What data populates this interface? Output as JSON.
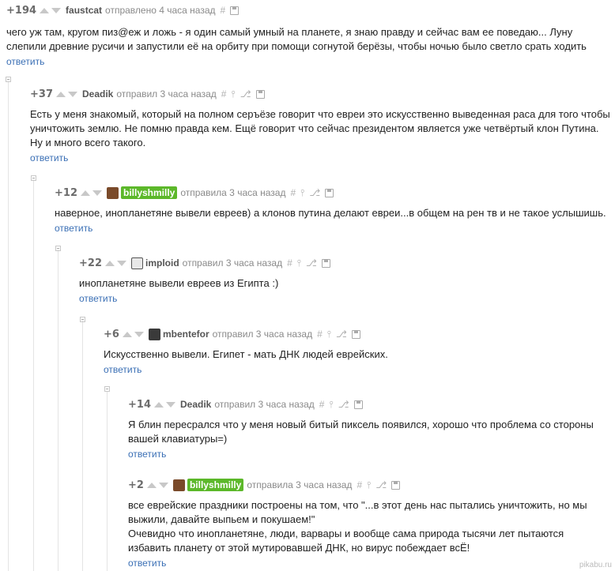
{
  "reply_label": "ответить",
  "watermark": "pikabu.ru",
  "comments": [
    {
      "rating": "+194",
      "author": "faustcat",
      "highlight": false,
      "meta": "отправлено 4 часа назад",
      "text": "чего уж там, кругом пиз@еж и ложь - я один самый умный на планете, я знаю правду и сейчас вам ее поведаю... Луну слепили древние русичи и запустили её на орбиту при помощи согнутой берёзы, чтобы ночью было светло срать ходить"
    },
    {
      "rating": "+37",
      "author": "Deadik",
      "highlight": false,
      "meta": "отправил 3 часа назад",
      "text": "Есть у меня знакомый, который на полном серъёзе говорит что евреи это искусственно выведенная раса для того чтобы уничтожить землю. Не помню правда кем. Ещё говорит что сейчас президентом является уже четвёртый клон Путина. Ну и много всего такого."
    },
    {
      "rating": "+12",
      "author": "billyshmilly",
      "highlight": true,
      "meta": "отправила 3 часа назад",
      "text": "наверное, инопланетяне вывели евреев) а клонов путина делают евреи...в общем на рен тв и не такое услышишь."
    },
    {
      "rating": "+22",
      "author": "imploid",
      "highlight": false,
      "meta": "отправил 3 часа назад",
      "text": "инопланетяне вывели евреев из Египта :)"
    },
    {
      "rating": "+6",
      "author": "mbentefor",
      "highlight": false,
      "meta": "отправил 3 часа назад",
      "text": "Искусственно вывели. Египет - мать ДНК людей еврейских."
    },
    {
      "rating": "+14",
      "author": "Deadik",
      "highlight": false,
      "meta": "отправил 3 часа назад",
      "text": "Я блин пересрался что у меня новый битый пиксель появился, хорошо что проблема со стороны вашей клавиатуры=)"
    },
    {
      "rating": "+2",
      "author": "billyshmilly",
      "highlight": true,
      "meta": "отправила 3 часа назад",
      "text": " все еврейские праздники построены на том, что \"...в этот день нас пытались уничтожить, но мы выжили, давайте выпьем и покушаем!\"\nОчевидно что инопланетяне, люди, варвары и вообще сама природа тысячи лет пытаются избавить планету от этой мутировавшей ДНК, но вирус побеждает всЁ!"
    }
  ]
}
